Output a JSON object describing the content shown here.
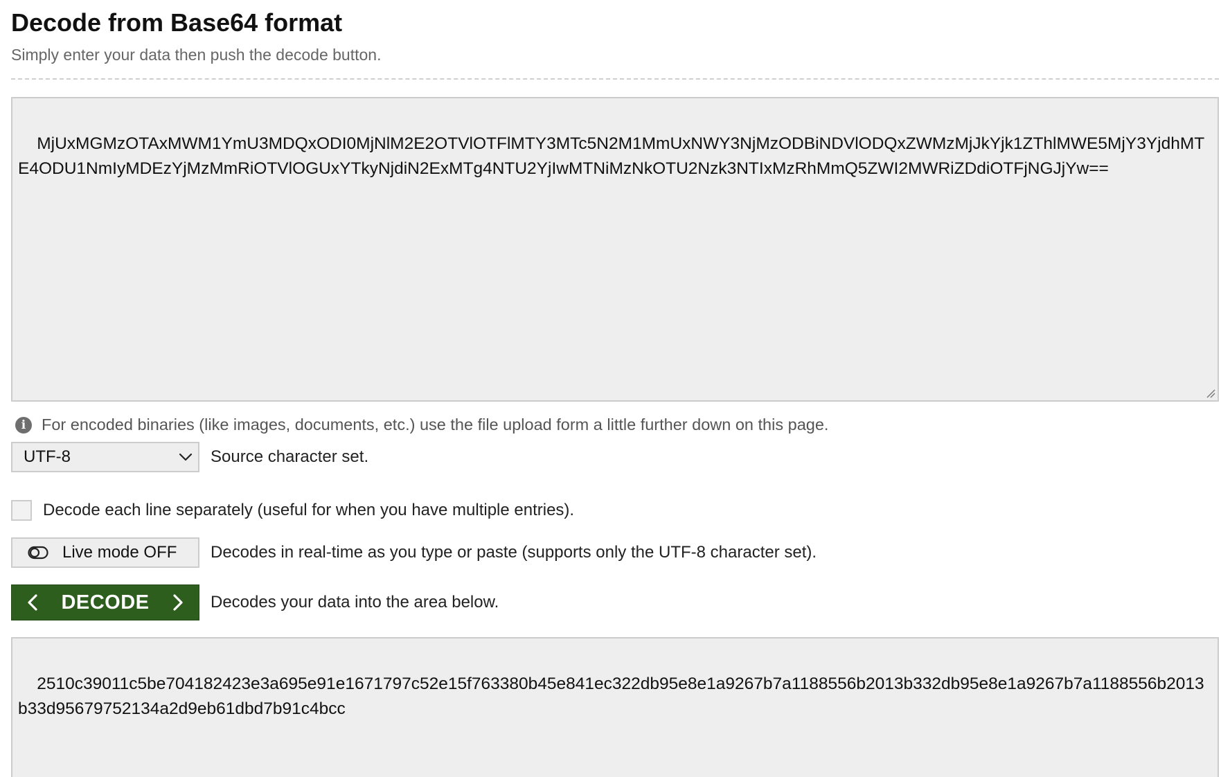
{
  "header": {
    "title": "Decode from Base64 format",
    "subtitle": "Simply enter your data then push the decode button."
  },
  "input": {
    "value": "MjUxMGMzOTAxMWM1YmU3MDQxODI0MjNlM2E2OTVlOTFlMTY3MTc5N2M1MmUxNWY3NjMzODBiNDVlODQxZWMzMjJkYjk1ZThlMWE5MjY3YjdhMTE4ODU1NmIyMDEzYjMzMmRiOTVlOGUxYTkyNjdiN2ExMTg4NTU2YjIwMTNiMzNkOTU2Nzk3NTIxMzRhMmQ5ZWI2MWRiZDdiOTFjNGJjYw=="
  },
  "info": {
    "icon": "info-icon",
    "text": "For encoded binaries (like images, documents, etc.) use the file upload form a little further down on this page."
  },
  "charset": {
    "selected": "UTF-8",
    "label": "Source character set."
  },
  "line_separately": {
    "checked": false,
    "label": "Decode each line separately (useful for when you have multiple entries)."
  },
  "live_mode": {
    "button_label": "Live mode OFF",
    "description": "Decodes in real-time as you type or paste (supports only the UTF-8 character set)."
  },
  "decode": {
    "button_label": "DECODE",
    "description": "Decodes your data into the area below."
  },
  "output": {
    "value": "2510c39011c5be704182423e3a695e91e1671797c52e15f763380b45e841ec322db95e8e1a9267b7a1188556b2013b332db95e8e1a9267b7a1188556b2013b33d95679752134a2d9eb61dbd7b91c4bcc"
  },
  "colors": {
    "decode_button": "#2e5e1e",
    "field_background": "#eeeeee",
    "field_border": "#cccccc"
  }
}
